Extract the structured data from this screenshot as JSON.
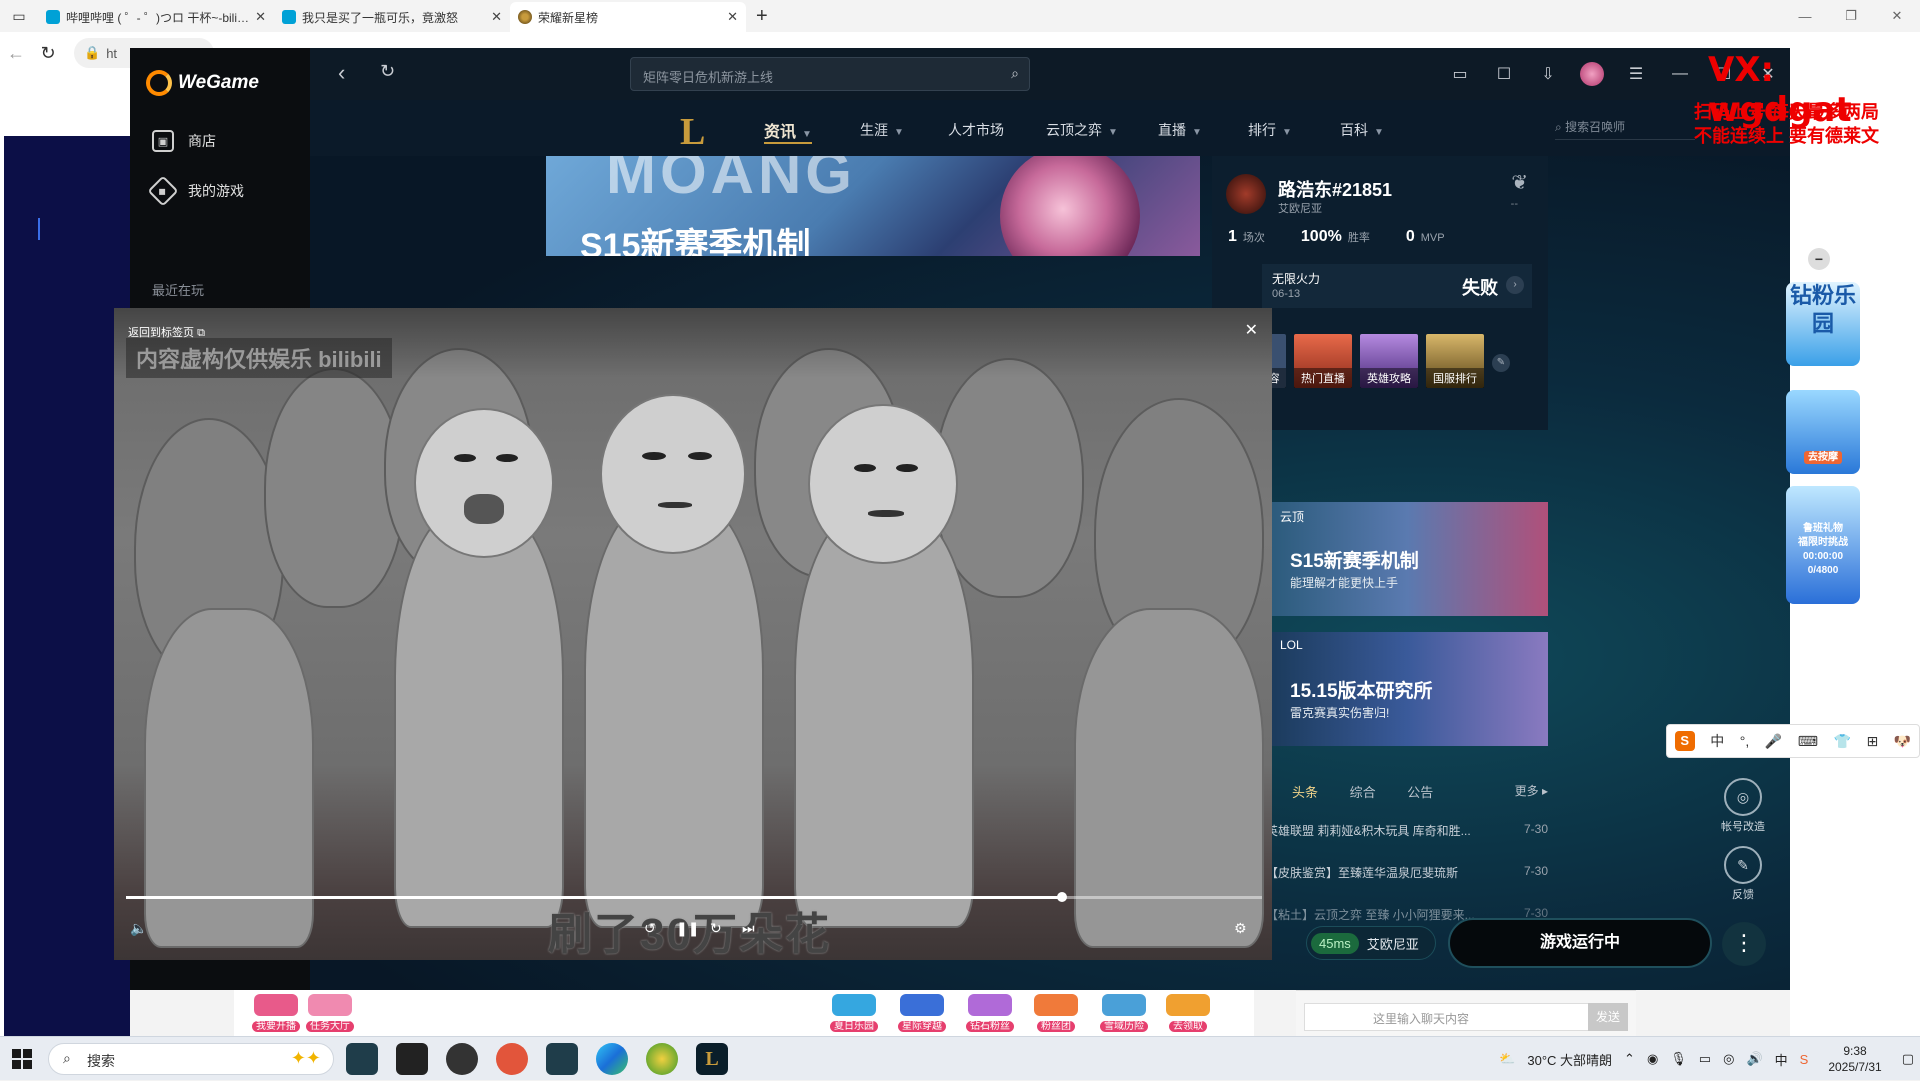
{
  "browser": {
    "tabs": [
      {
        "title": "哔哩哔哩 ( ゜- ゜)つロ 干杯~-bilibili",
        "active": false
      },
      {
        "title": "我只是买了一瓶可乐，竟激怒",
        "active": false
      },
      {
        "title": "荣耀新星榜",
        "active": true
      }
    ],
    "url": "ht"
  },
  "wegame": {
    "logo": "WeGame",
    "nav": [
      {
        "label": "商店"
      },
      {
        "label": "我的游戏"
      }
    ],
    "recent_label": "最近在玩",
    "search_placeholder": "矩阵零日危机新游上线"
  },
  "lol": {
    "nav": [
      {
        "label": "资讯",
        "caret": true,
        "active": true
      },
      {
        "label": "生涯",
        "caret": true
      },
      {
        "label": "人才市场",
        "caret": false
      },
      {
        "label": "云顶之弈",
        "caret": true
      },
      {
        "label": "直播",
        "caret": true
      },
      {
        "label": "排行",
        "caret": true
      },
      {
        "label": "百科",
        "caret": true
      }
    ],
    "search_placeholder": "搜索召唤师",
    "banner": {
      "big": "MOANG",
      "title": "S15新赛季机制"
    },
    "profile": {
      "name": "路浩东#21851",
      "server": "艾欧尼亚",
      "dash": "--",
      "stats": [
        {
          "value": "1",
          "label": "场次"
        },
        {
          "value": "100%",
          "label": "胜率"
        },
        {
          "value": "0",
          "label": "MVP"
        }
      ],
      "match": {
        "mode": "无限火力",
        "date": "06-13",
        "result": "失败"
      },
      "tiles": [
        {
          "label": "容",
          "color": "#3a5070"
        },
        {
          "label": "热门直播",
          "color": "#c0392b"
        },
        {
          "label": "英雄攻略",
          "color": "#6a4c93"
        },
        {
          "label": "国服排行",
          "color": "#8a6a2e"
        }
      ]
    },
    "cards": [
      {
        "tag": "云顶",
        "title": "S15新赛季机制",
        "sub": "能理解才能更快上手"
      },
      {
        "tag": "LOL",
        "title": "15.15版本研究所",
        "sub": "雷克赛真实伤害归!"
      }
    ],
    "news_tabs": [
      "头条",
      "综合",
      "公告"
    ],
    "news_more": "更多 ▸",
    "news": [
      {
        "text": "英雄联盟 莉莉娅&积木玩具 库奇和胜...",
        "date": "7-30"
      },
      {
        "text": "【皮肤鉴赏】至臻莲华温泉厄斐琉斯",
        "date": "7-30"
      },
      {
        "text": "【粘土】云顶之弈 至臻 小小阿狸要来...",
        "date": "7-30"
      }
    ],
    "ping": "45ms",
    "region": "艾欧尼亚",
    "play_status": "游戏运行中",
    "side_buttons": [
      "帐号改造",
      "反馈"
    ]
  },
  "video": {
    "back_home": "返回到标签页",
    "watermark": "内容虚构仅供娱乐 bilibili",
    "subtitle": "刷了30万朵花",
    "progress": 0.824
  },
  "bottom_strip": {
    "chips": [
      {
        "label": "我要开播",
        "color": "#e85a8a"
      },
      {
        "label": "任务大厅",
        "color": "#f08ab0"
      },
      {
        "label": "夏日乐园",
        "color": "#35a7e0"
      },
      {
        "label": "星际穿越",
        "color": "#3a6fd8"
      },
      {
        "label": "钻石粉丝",
        "color": "#b06ad8"
      },
      {
        "label": "粉丝团",
        "color": "#f07a3a"
      },
      {
        "label": "雪域历险",
        "color": "#4aa0d8"
      },
      {
        "label": "去领取",
        "color": "#f0a030"
      }
    ],
    "chat_placeholder": "这里输入聊天内容",
    "send": "发送"
  },
  "overlay": {
    "vx": "VX: wgdgat",
    "line1": "扫码上号 每天最多两局",
    "line2": "不能连续上 要有德莱文",
    "promos": [
      "钻粉乐园",
      "去按摩",
      "鲁班礼物",
      "福限时挑战",
      "00:00:00",
      "0/4800"
    ]
  },
  "ime": [
    "中",
    "°,",
    "🎤",
    "⌨",
    "👕",
    "⊞",
    "🐶"
  ],
  "taskbar": {
    "search": "搜索",
    "weather": "30°C 大部晴朗",
    "time": "9:38",
    "date": "2025/7/31",
    "ime_lang": "中"
  }
}
